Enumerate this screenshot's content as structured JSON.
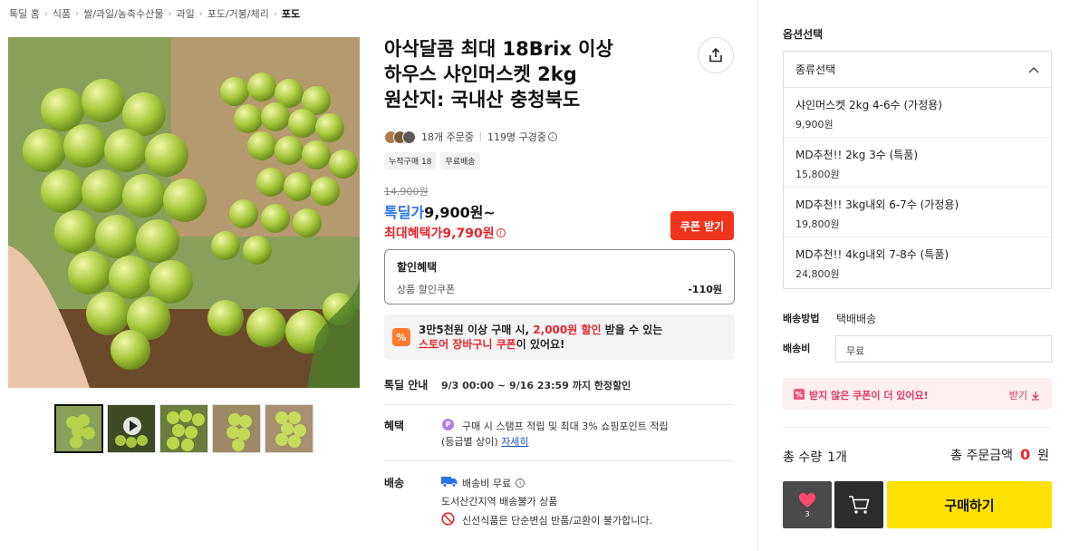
{
  "breadcrumb": [
    "톡딜 홈",
    "식품",
    "쌀/과일/농축수산물",
    "과일",
    "포도/거봉/체리",
    "포도"
  ],
  "product": {
    "title_lines": [
      "아삭달콤 최대 18Brix 이상",
      "하우스 샤인머스켓 2kg",
      "원산지: 국내산 충청북도"
    ],
    "orders": "18개 주문중",
    "viewers": "119명 구경중",
    "tags": [
      "누적구매 18",
      "무료배송"
    ],
    "original_price": "14,900원",
    "deal_label": "톡딜가",
    "deal_price": "9,900원~",
    "max_label": "최대혜택가",
    "max_price": "9,790원",
    "coupon_button": "쿠폰 받기"
  },
  "discount": {
    "title": "할인혜택",
    "row_label": "상품 할인쿠폰",
    "row_value": "-110원"
  },
  "promo": {
    "icon": "%",
    "line1_a": "3만5천원 이상 구매 시, ",
    "line1_red": "2,000원 할인",
    "line1_b": " 받을 수 있는",
    "line2_red": "스토어 장바구니 쿠폰",
    "line2_b": "이 있어요!"
  },
  "deal_info": {
    "label": "톡딜 안내",
    "value": "9/3 00:00 ~ 9/16 23:59 까지 한정할인"
  },
  "benefit": {
    "label": "혜택",
    "line1": "구매 시 스탬프 적립 및 최대 3% 쇼핑포인트 적립",
    "line2": "(등급별 상이)",
    "link": "자세히"
  },
  "delivery": {
    "label": "배송",
    "fee": "배송비 무료",
    "note1": "도서산간지역 배송불가 상품",
    "note2": "신선식품은 단순변심 반품/교환이 불가합니다."
  },
  "options": {
    "title": "옵션선택",
    "dropdown_label": "종류선택",
    "items": [
      {
        "name": "샤인머스켓 2kg 4-6수 (가정용)",
        "price": "9,900원"
      },
      {
        "name": "MD추천!! 2kg 3수 (특품)",
        "price": "15,800원"
      },
      {
        "name": "MD추천!! 3kg내외 6-7수 (가정용)",
        "price": "19,800원"
      },
      {
        "name": "MD추천!! 4kg내외 7-8수 (특품)",
        "price": "24,800원"
      }
    ]
  },
  "shipping": {
    "method_label": "배송방법",
    "method_value": "택배배송",
    "fee_label": "배송비",
    "fee_value": "무료"
  },
  "coupon_banner": {
    "text": "받지 않은 쿠폰이 더 있어요!",
    "action": "받기"
  },
  "totals": {
    "qty_label": "총 수량",
    "qty_value": "1개",
    "sum_label": "총 주문금액",
    "sum_value": "0",
    "sum_unit": "원"
  },
  "actions": {
    "wish_count": "3",
    "buy_label": "구매하기"
  },
  "colors": {
    "accent_red": "#e5262c",
    "deal_blue": "#2a72e5",
    "buy_yellow": "#ffe100",
    "coupon_red": "#f0341e"
  }
}
